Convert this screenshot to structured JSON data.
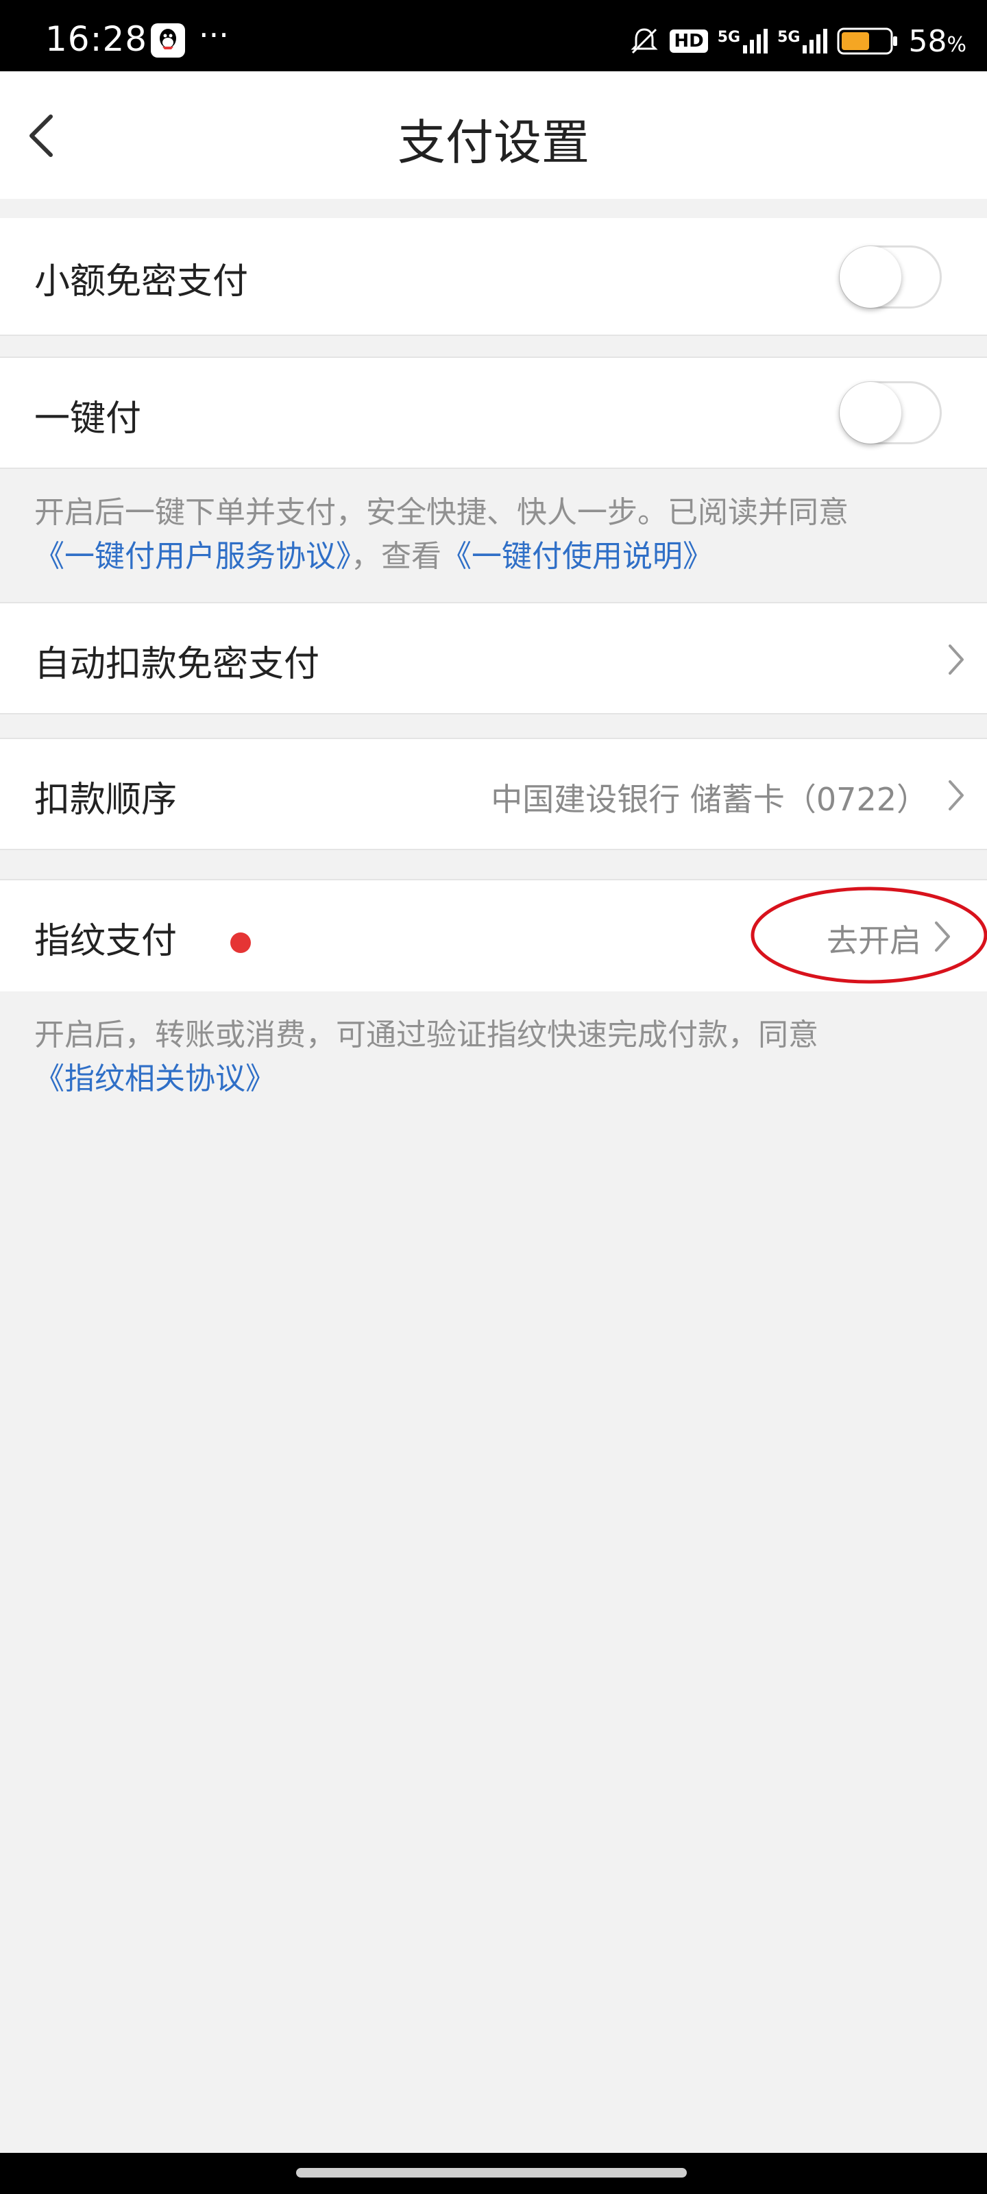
{
  "status_bar": {
    "time": "16:28",
    "more": "···",
    "hd_badge": "HD",
    "network_1": "5G",
    "network_2": "5G",
    "battery_percent": "58",
    "battery_unit": "%"
  },
  "header": {
    "title": "支付设置"
  },
  "settings": {
    "small_no_pwd": {
      "label": "小额免密支付",
      "enabled": false
    },
    "one_click": {
      "label": "一键付",
      "enabled": false
    },
    "one_click_note": {
      "text": "开启后一键下单并支付，安全快捷、快人一步。已阅读并同意",
      "agreement_link": "《一键付用户服务协议》",
      "middle": "，查看",
      "guide_link": "《一键付使用说明》"
    },
    "auto_deduct": {
      "label": "自动扣款免密支付"
    },
    "deduct_order": {
      "label": "扣款顺序",
      "value": "中国建设银行 储蓄卡（0722）"
    },
    "fingerprint": {
      "label": "指纹支付",
      "action": "去开启"
    },
    "fingerprint_note": {
      "text": "开启后，转账或消费，可通过验证指纹快速完成付款，同意",
      "agreement_link": "《指纹相关协议》"
    }
  },
  "colors": {
    "link": "#2f6fc7",
    "red_dot": "#e53535",
    "annotation": "#d8121c"
  }
}
